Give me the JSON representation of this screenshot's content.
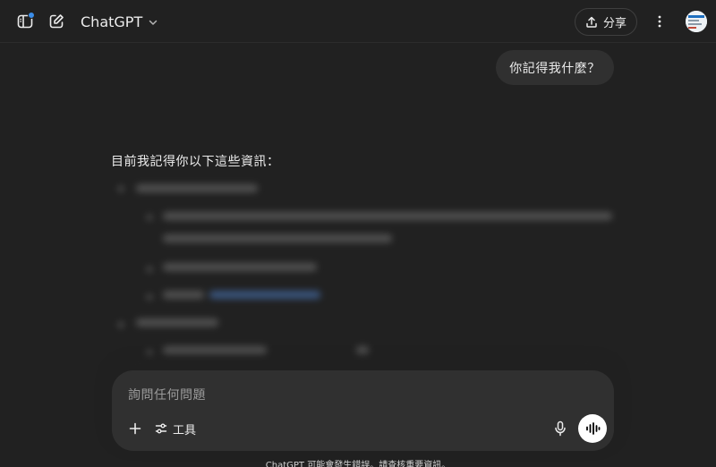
{
  "header": {
    "model_name": "ChatGPT",
    "share_label": "分享"
  },
  "conversation": {
    "user_message": "你記得我什麼？",
    "assistant_intro": "目前我記得你以下這些資訊："
  },
  "composer": {
    "placeholder": "詢問任何問題",
    "tools_label": "工具"
  },
  "footer": {
    "disclaimer": "ChatGPT 可能會發生錯誤。請查核重要資訊。"
  },
  "colors": {
    "background": "#212121",
    "bubble": "#303030",
    "notification_dot": "#3b8eea"
  },
  "icons": [
    "sidebar-toggle-icon",
    "new-chat-icon",
    "chevron-down-icon",
    "share-icon",
    "more-vertical-icon",
    "avatar",
    "plus-icon",
    "tools-icon",
    "microphone-icon",
    "voice-waveform-icon"
  ]
}
